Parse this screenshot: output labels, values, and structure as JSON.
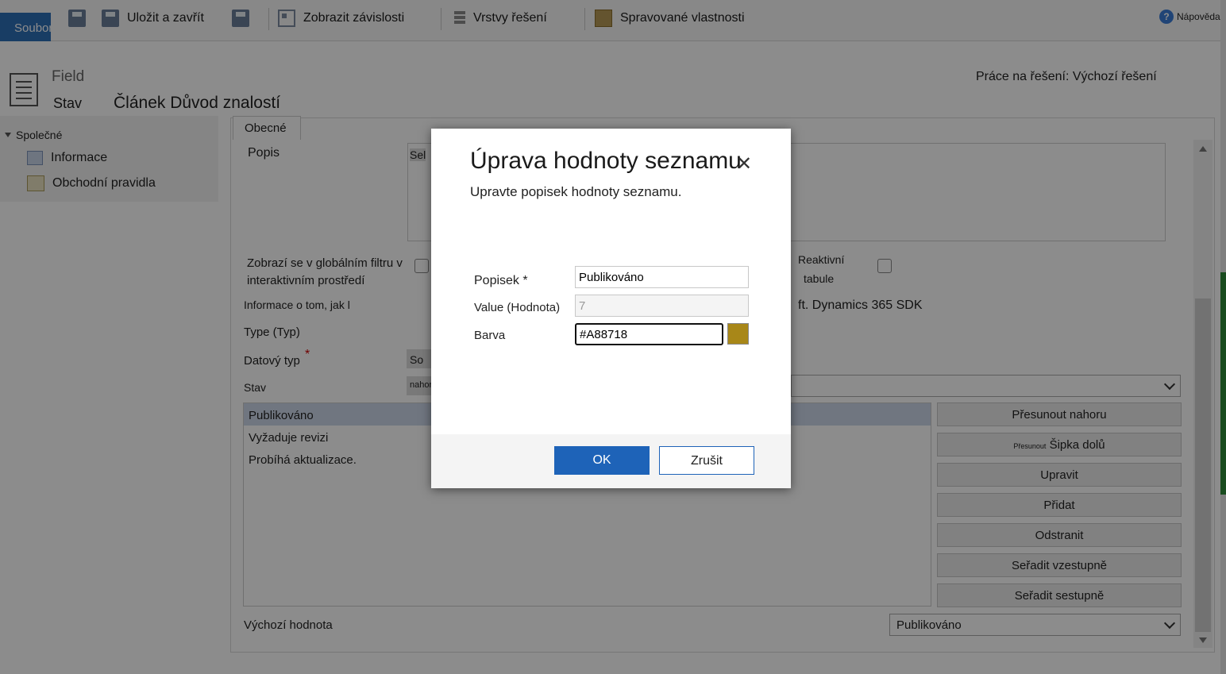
{
  "toolbar": {
    "file_label": "Soubor",
    "save_close_label": "Uložit a zavřít",
    "show_dependencies_label": "Zobrazit závislosti",
    "solution_layers_label": "Vrstvy řešení",
    "managed_properties_label": "Spravované vlastnosti",
    "help_label": "Nápověda"
  },
  "header": {
    "entity_type": "Field",
    "field_name": "Stav",
    "entity_name": "Článek Důvod znalostí",
    "solution": "Práce na řešení: Výchozí řešení"
  },
  "leftnav": {
    "group": "Společné",
    "items": [
      {
        "label": "Informace",
        "icon": "info-icon"
      },
      {
        "label": "Obchodní pravidla",
        "icon": "business-rules-icon"
      }
    ]
  },
  "form": {
    "tab_label": "Obecné",
    "description_label": "Popis",
    "description_value": "Sel",
    "global_filter_label": "Zobrazí se v globálním filtru v interaktivním prostředí",
    "reactive_partial_1": "Reaktivní",
    "reactive_partial_2": "tabule",
    "info_label": "Informace o tom, jak l",
    "sdk_text": "ft. Dynamics 365 SDK",
    "type_label": "Type (Typ)",
    "datatype_label": "Datový typ",
    "datatype_value": "So",
    "status_label": "Stav",
    "status_partial": "nahoru",
    "list_items": [
      "Publikováno",
      "Vyžaduje revizi",
      "Probíhá aktualizace."
    ],
    "buttons": [
      "Přesunout nahoru",
      "Upravit",
      "Přidat",
      "Odstranit",
      "Seřadit vzestupně",
      "Seřadit sestupně"
    ],
    "move_down_small": "Přesunout",
    "move_down_label": "Šipka dolů",
    "default_label": "Výchozí hodnota",
    "default_value": "Publikováno"
  },
  "dialog": {
    "title": "Úprava hodnoty seznamu",
    "close_glyph": "✕",
    "subtitle": "Upravte popisek hodnoty seznamu.",
    "label_field": "Popisek *",
    "label_value": "Publikováno",
    "value_field": "Value (Hodnota)",
    "value_value": "7",
    "color_field": "Barva",
    "color_value": "#A88718",
    "ok_label": "OK",
    "cancel_label": "Zrušit"
  },
  "colors": {
    "accent": "#1e63b8",
    "swatch": "#A88718"
  }
}
